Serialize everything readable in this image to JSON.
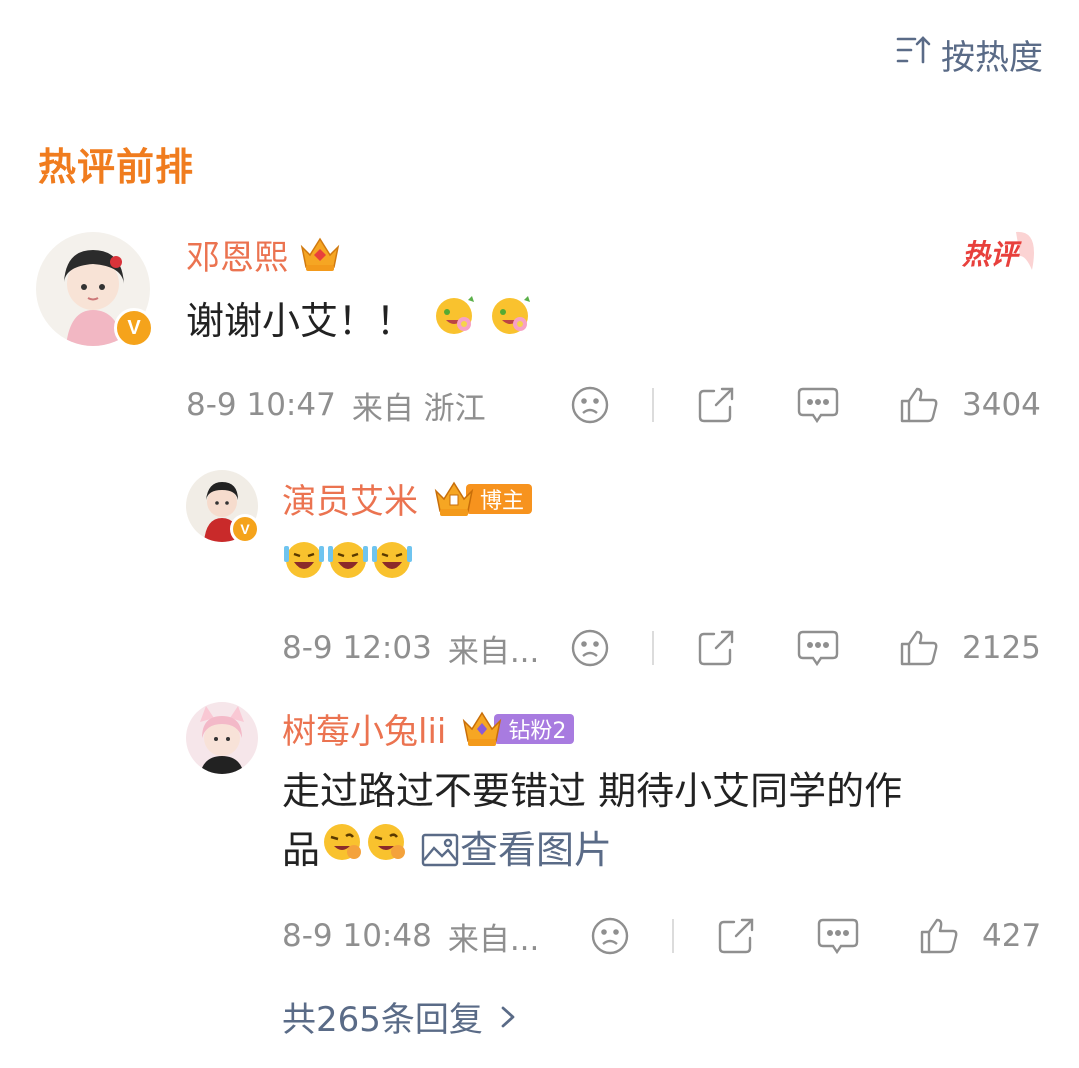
{
  "sort": {
    "label": "按热度",
    "icon": "sort-icon"
  },
  "section": {
    "title": "热评前排"
  },
  "hot_badge": "热评",
  "main_comment": {
    "username": "邓恩熙",
    "text": "谢谢小艾！！",
    "time": "8-9 10:47",
    "location": "来自 浙江",
    "likes": "3404",
    "verified_badge": "V"
  },
  "replies": [
    {
      "username": "演员艾米",
      "tag": "博主",
      "time": "8-9 12:03",
      "location": "来自...",
      "likes": "2125"
    },
    {
      "username": "树莓小兔lii",
      "tag": "钻粉2",
      "text_line1": "走过路过不要错过 期待小艾同学的作",
      "text_line2": "品",
      "view_image": "查看图片",
      "time": "8-9 10:48",
      "location": "来自...",
      "likes": "427"
    }
  ],
  "more_replies": "共265条回复",
  "colors": {
    "accent": "#f07c1e",
    "username": "#eb7350",
    "link": "#5a6b87",
    "meta": "#8f8f8f",
    "hot": "#e8403c"
  }
}
